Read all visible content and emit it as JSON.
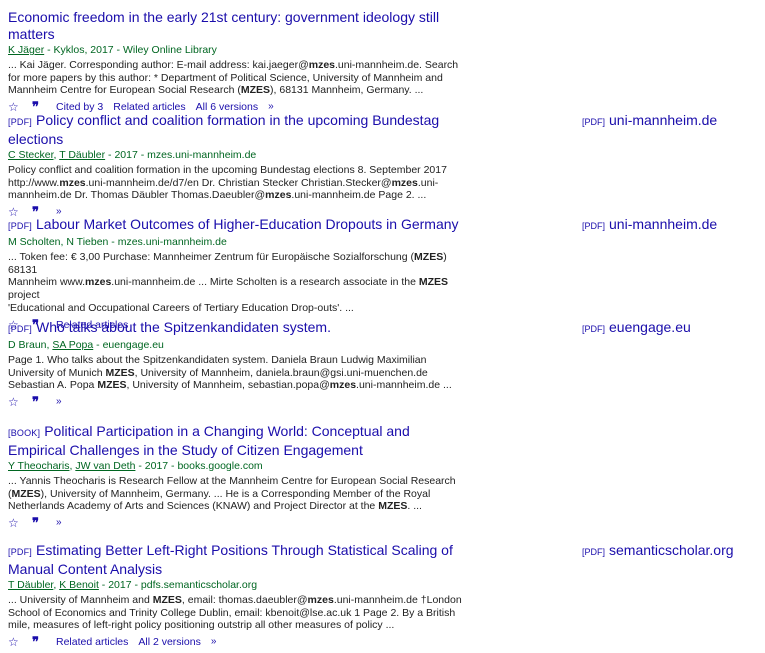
{
  "results": [
    {
      "title": "Economic freedom in the early 21st century: government ideology still matters",
      "authors": [
        "K Jäger"
      ],
      "meta_rest": " - Kyklos, 2017 - Wiley Online Library",
      "snippet": [
        "... Kai Jäger. Corresponding author: E-mail address: kai.jaeger@",
        "mzes",
        ".uni-mannheim.de. Search",
        "\nfor more papers by this author: * Department of Political Science, University of Mannheim and\nMannheim Centre for European Social Research (",
        "MZES",
        "), 68131 Mannheim, Germany. ..."
      ],
      "actions": [
        "Cited by 3",
        "Related articles",
        "All 6 versions"
      ]
    },
    {
      "tag": "[PDF]",
      "title": "Policy conflict and coalition formation in the upcoming Bundestag elections",
      "authors": [
        "C Stecker",
        "T Däubler"
      ],
      "meta_rest": " - 2017 - mzes.uni-mannheim.de",
      "snippet": [
        "Policy conflict and coalition formation in the upcoming Bundestag elections 8. September 2017\nhttp://www.",
        "mzes",
        ".uni-mannheim.de/d7/en Dr. Christian Stecker Christian.Stecker@",
        "mzes",
        ".uni-\nmannheim.de Dr. Thomas Däubler Thomas.Daeubler@",
        "mzes",
        ".uni-mannheim.de Page 2. ..."
      ],
      "side_tag": "[PDF]",
      "side_text": "uni-mannheim.de"
    },
    {
      "tag": "[PDF]",
      "title": "Labour Market Outcomes of Higher-Education Dropouts in Germany",
      "authors_plain": "M Scholten, N Tieben",
      "meta_rest": " - mzes.uni-mannheim.de",
      "snippet": [
        "... Token fee: € 3,00 Purchase: Mannheimer Zentrum für Europäische Sozialforschung (",
        "MZES",
        ") 68131\nMannheim www.",
        "mzes",
        ".uni-mannheim.de ... Mirte Scholten is a research associate in the ",
        "MZES",
        " project\n'Educational and Occupational Careers of Tertiary Education Drop-outs'. ..."
      ],
      "actions": [
        "Related articles"
      ],
      "side_tag": "[PDF]",
      "side_text": "uni-mannheim.de"
    },
    {
      "tag": "[PDF]",
      "title": "Who talks about the Spitzenkandidaten system.",
      "authors_mixed": [
        "D Braun, ",
        "SA Popa"
      ],
      "meta_rest": " - euengage.eu",
      "snippet": [
        "Page 1. Who talks about the Spitzenkandidaten system. Daniela Braun Ludwig Maximilian\nUniversity of Munich ",
        "MZES",
        ", University of Mannheim, daniela.braun@gsi.uni-muenchen.de\nSebastian A. Popa ",
        "MZES",
        ", University of Mannheim, sebastian.popa@",
        "mzes",
        ".uni-mannheim.de ..."
      ],
      "side_tag": "[PDF]",
      "side_text": "euengage.eu"
    },
    {
      "tag": "[BOOK]",
      "title": "Political Participation in a Changing World: Conceptual and Empirical Challenges in the Study of Citizen Engagement",
      "authors": [
        "Y Theocharis",
        "JW van Deth"
      ],
      "meta_rest": " - 2017 - books.google.com",
      "snippet": [
        "... Yannis Theocharis is Research Fellow at the Mannheim Centre for European Social Research\n(",
        "MZES",
        "), University of Mannheim, Germany. ... He is a Corresponding Member of the Royal\nNetherlands Academy of Arts and Sciences (KNAW) and Project Director at the ",
        "MZES",
        ". ..."
      ]
    },
    {
      "tag": "[PDF]",
      "title": "Estimating Better Left-Right Positions Through Statistical Scaling of Manual Content Analysis",
      "authors": [
        "T Däubler",
        "K Benoit"
      ],
      "meta_rest": " - 2017 - pdfs.semanticscholar.org",
      "snippet": [
        "... University of Mannheim and ",
        "MZES",
        ", email: thomas.daeubler@",
        "mzes",
        ".uni-mannheim.de †London\nSchool of Economics and Trinity College Dublin, email: kbenoit@lse.ac.uk 1 Page 2. By a British\nmile, measures of left-right policy positioning outstrip all other measures of policy ..."
      ],
      "actions": [
        "Related articles",
        "All 2 versions"
      ],
      "side_tag": "[PDF]",
      "side_text": "semanticscholar.org"
    }
  ],
  "icons": {
    "save": "star-icon",
    "cite": "quote-icon",
    "more": "chevron-double-icon"
  },
  "colors": {
    "link": "#1a0dab",
    "meta": "#006621",
    "text": "#222222"
  }
}
